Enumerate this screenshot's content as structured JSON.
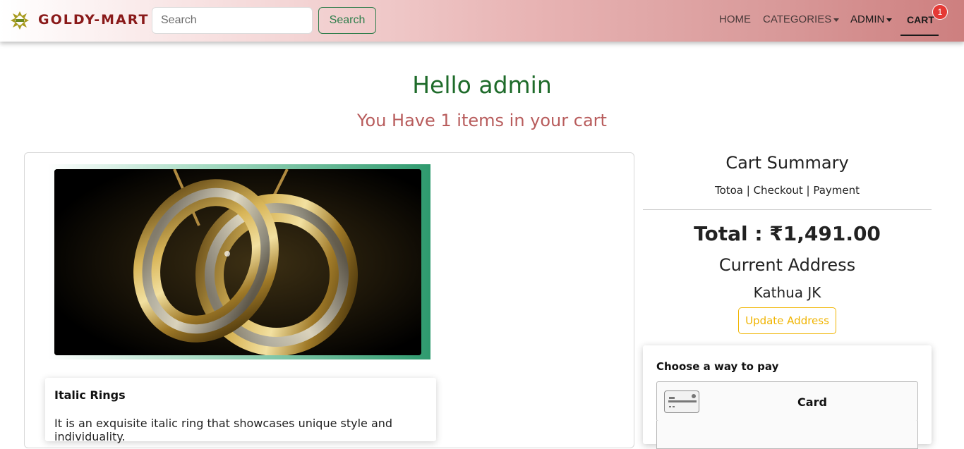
{
  "navbar": {
    "brand": "GOLDY-MART",
    "search_placeholder": "Search",
    "search_button": "Search",
    "links": {
      "home": "HOME",
      "categories": "CATEGORIES",
      "admin": "ADMIN",
      "cart": "CART"
    },
    "cart_count": "1"
  },
  "greeting": {
    "hello": "Hello admin",
    "items": "You Have 1 items in your cart"
  },
  "product": {
    "name": "Italic Rings",
    "description": "It is an exquisite italic ring that showcases unique style and individuality."
  },
  "summary": {
    "title": "Cart Summary",
    "subtitle": "Totoa | Checkout | Payment",
    "total": "Total : ₹1,491.00",
    "address_title": "Current Address",
    "address": "Kathua JK",
    "update_button": "Update Address"
  },
  "payment": {
    "title": "Choose a way to pay",
    "options": [
      {
        "label": "Card",
        "icon": "credit-card-icon"
      }
    ]
  },
  "colors": {
    "brand": "#8a1a1a",
    "hello": "#1e6b2a",
    "items": "#b85c5c",
    "update_button": "#f0b400",
    "search_button": "#2d7d4a",
    "badge": "#e53935"
  }
}
